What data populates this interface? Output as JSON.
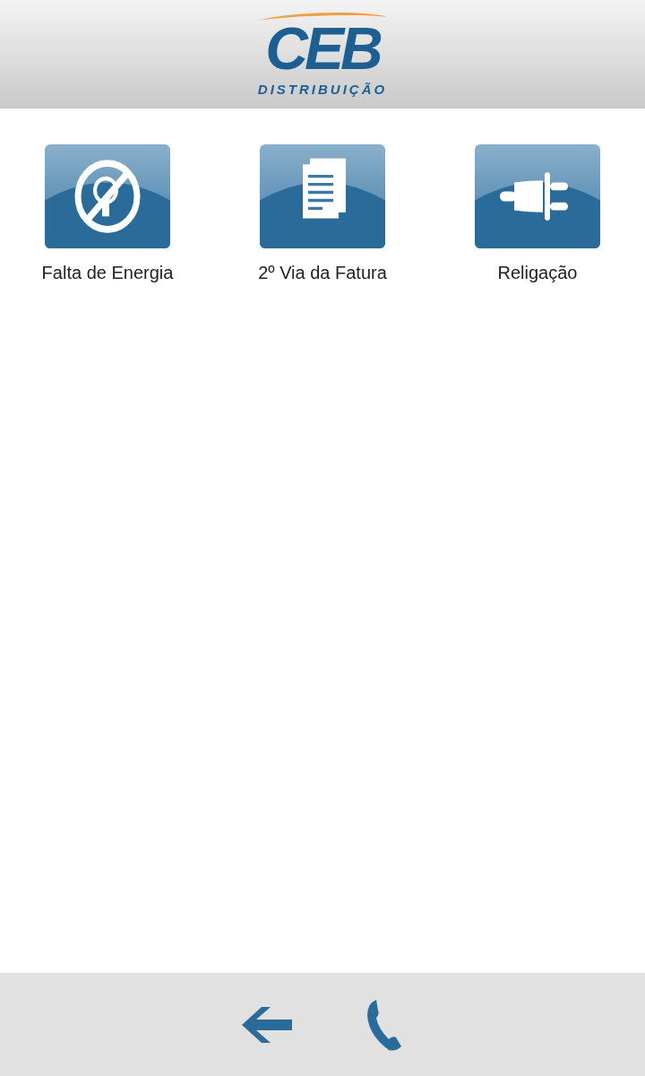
{
  "header": {
    "logo_text": "CEB",
    "logo_subtitle": "DISTRIBUIÇÃO"
  },
  "menu": [
    {
      "kind": "no-light",
      "label": "Falta de Energia"
    },
    {
      "kind": "document",
      "label": "2º Via da Fatura"
    },
    {
      "kind": "plug",
      "label": "Religação"
    }
  ],
  "footer": {
    "buttons": [
      {
        "kind": "back"
      },
      {
        "kind": "phone"
      }
    ]
  }
}
